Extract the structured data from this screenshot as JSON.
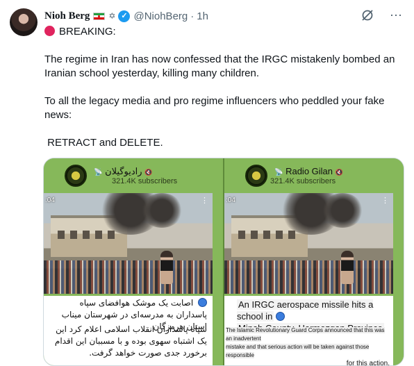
{
  "author": {
    "display_name": "Nioh Berg",
    "handle": "@NiohBerg",
    "separator": "·",
    "time": "1h"
  },
  "icons": {
    "flag": "iran-flag-icon",
    "emblem": "star-of-david-icon",
    "verified": "verified-badge-icon",
    "grok": "grok-icon",
    "more": "more-options-icon",
    "breaking": "red-circle-icon"
  },
  "tweet": {
    "line_breaking": "BREAKING:",
    "para1": "The regime in Iran has now confessed that the IRGC mistakenly bombed an Iranian school yesterday, killing many children.",
    "para2": "To all the legacy media and pro regime influencers who peddled your fake news:",
    "para3": " RETRACT and DELETE."
  },
  "media": {
    "left": {
      "channel_name": "رادیوگیلان",
      "subscribers": "321.4K subscribers",
      "video_time": ":04",
      "caption_line1": "اصابت یک موشک هوافضای سپاه پاسداران به مدرسه‌ای در شهرستان میناب استان هرمزگان",
      "caption_line2": "سپاه پاسداران انقلاب اسلامی اعلام کرد این یک اشتباه سهوی بوده و با مسببان این اقدام برخورد جدی صورت خواهد گرفت."
    },
    "right": {
      "channel_name": "Radio Gilan",
      "subscribers": "321.4K subscribers",
      "video_time": ":04",
      "caption_line1a": "An IRGC aerospace missile hits a school in",
      "caption_line1b": "Minab County, Hormozgan Province",
      "caption_line2a": "The Islamic Revolutionary Guard Corps announced that this was an inadvertent",
      "caption_line2b": "mistake and that serious action will be taken against those responsible",
      "caption_line2c": "for this action."
    }
  },
  "colors": {
    "text": "#0f1419",
    "muted": "#536471",
    "verified": "#1d9bf0",
    "breaking_red": "#e0245e",
    "telegram_green": "#86b85a"
  }
}
